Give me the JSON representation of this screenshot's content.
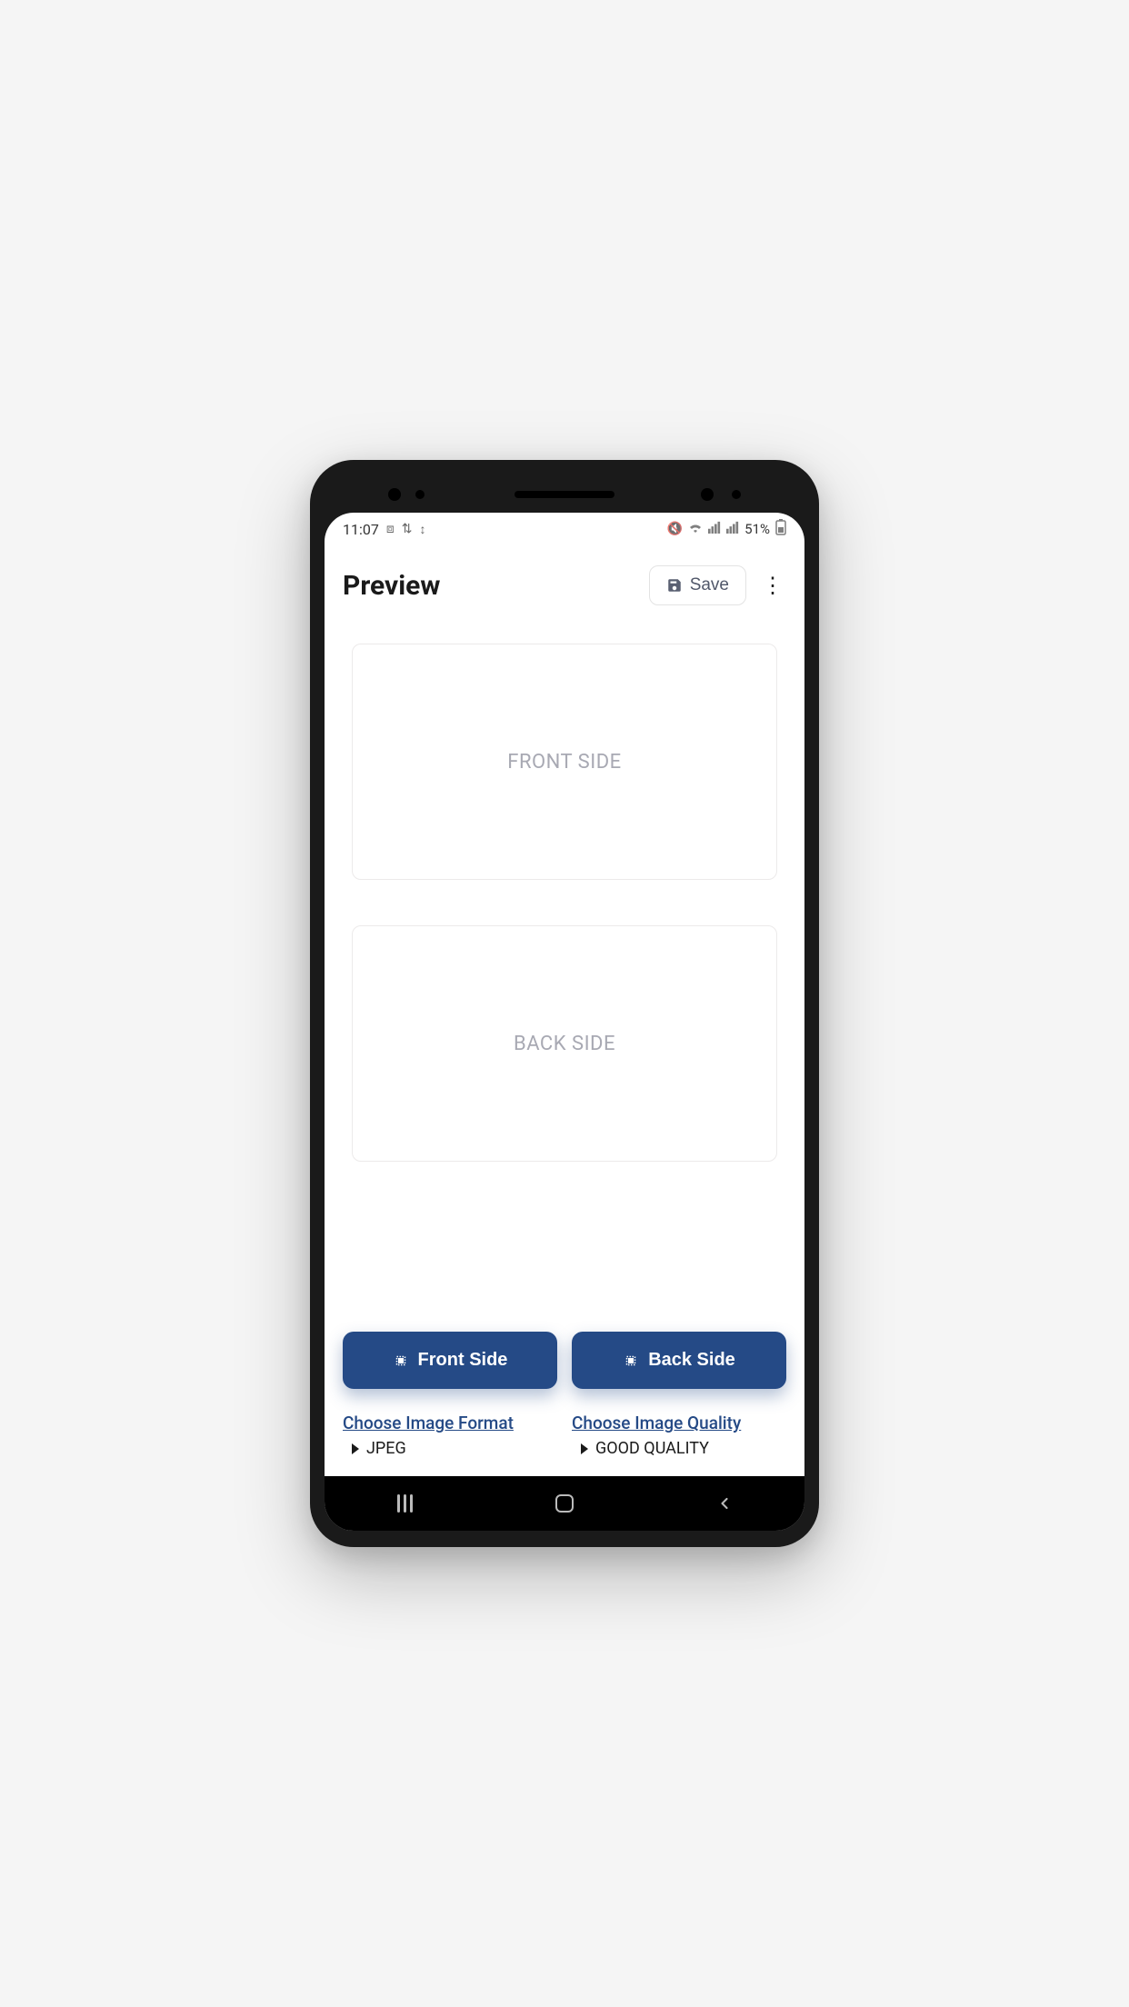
{
  "statusBar": {
    "time": "11:07",
    "battery": "51%"
  },
  "header": {
    "title": "Preview",
    "saveLabel": "Save"
  },
  "cards": {
    "frontLabel": "FRONT SIDE",
    "backLabel": "BACK SIDE"
  },
  "buttons": {
    "frontSide": "Front Side",
    "backSide": "Back Side"
  },
  "options": {
    "format": {
      "label": "Choose Image Format",
      "value": "JPEG"
    },
    "quality": {
      "label": "Choose Image Quality",
      "value": "GOOD QUALITY"
    }
  }
}
